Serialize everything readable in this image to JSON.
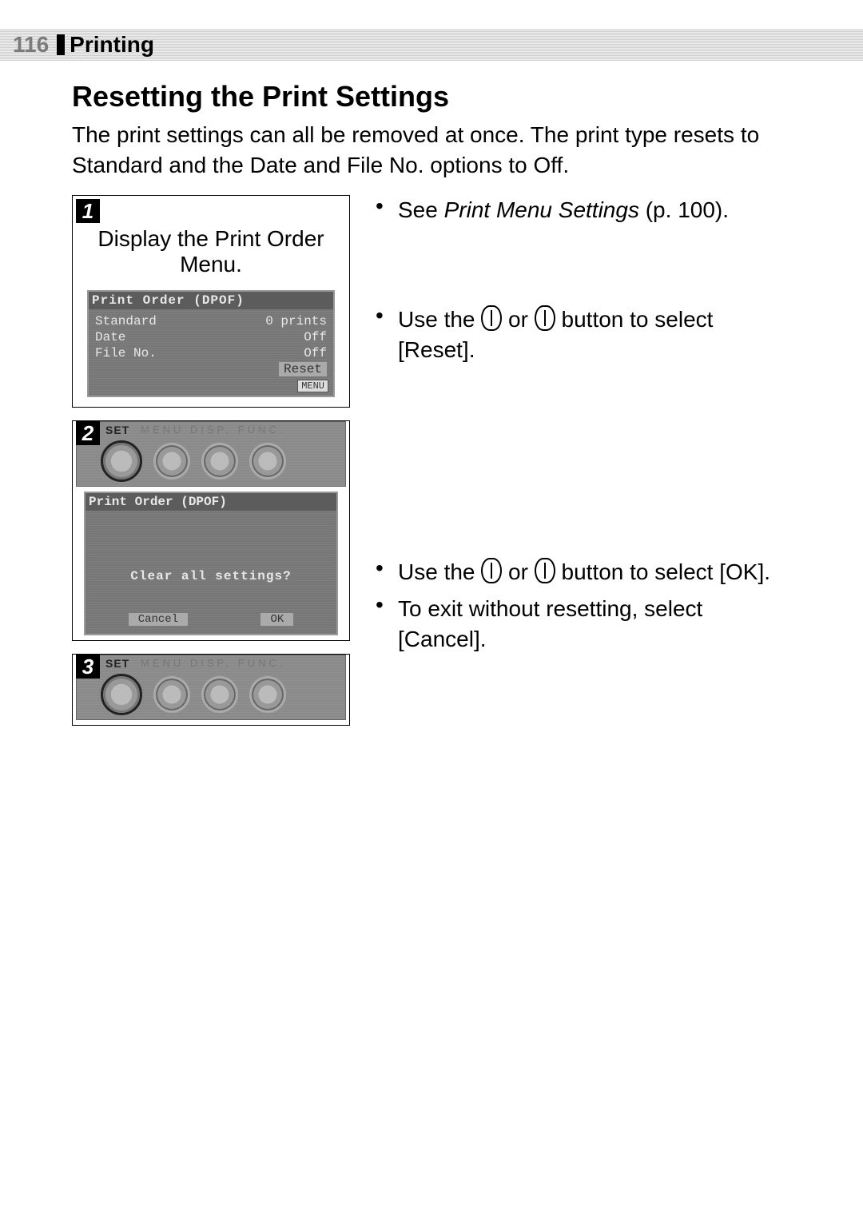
{
  "header": {
    "page_number": "116",
    "chapter": "Printing"
  },
  "section": {
    "title": "Resetting the Print Settings",
    "intro": "The print settings can all be removed at once. The print type resets to Standard and the Date and File No. options to Off."
  },
  "steps": {
    "step1": {
      "num": "1",
      "caption": "Display the Print Order Menu.",
      "lcd": {
        "title": "Print Order (DPOF)",
        "rows": [
          {
            "k": "Standard",
            "v": "0 prints"
          },
          {
            "k": "Date",
            "v": "Off"
          },
          {
            "k": "File No.",
            "v": "Off"
          }
        ],
        "highlight": "Reset",
        "menu_tag": "MENU"
      }
    },
    "step2": {
      "num": "2",
      "strip_label": "SET",
      "strip_sub": "MENU DISP. FUNC.",
      "lcd": {
        "title": "Print Order (DPOF)",
        "message": "Clear all settings?",
        "buttons": {
          "cancel": "Cancel",
          "ok": "OK"
        }
      }
    },
    "step3": {
      "num": "3",
      "strip_label": "SET",
      "strip_sub": "MENU DISP. FUNC."
    }
  },
  "right": {
    "r1_prefix": "See ",
    "r1_ital": "Print Menu Settings",
    "r1_suffix": " (p. 100).",
    "r2_a": "Use the ",
    "r2_b": " or ",
    "r2_c": " button to select [Reset].",
    "r3_a": "Use the ",
    "r3_b": " or ",
    "r3_c": " button to select [OK].",
    "r4": "To exit without resetting, select [Cancel]."
  }
}
